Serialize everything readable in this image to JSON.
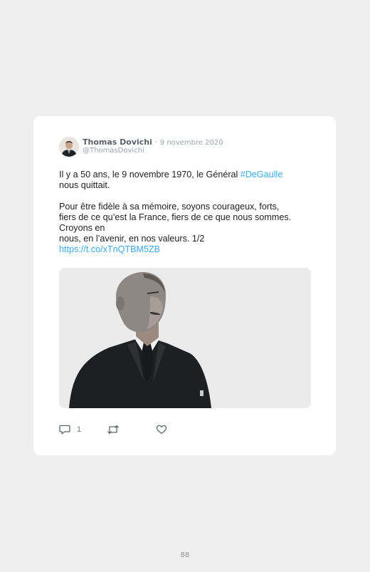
{
  "tweet": {
    "author_name": "Thomas Dovichi",
    "separator": "·",
    "date": "9 novembre 2020",
    "handle": "@ThomasDovichi",
    "line1_text": "Il y a 50 ans, le 9 novembre 1970, le Général ",
    "hashtag": "#DeGaulle",
    "line2_text": "nous quittait.",
    "para2_line1": "Pour être fidèle à sa mémoire, soyons courageux, forts,",
    "para2_line2": "fiers de ce qu’est la France, fiers de ce que nous sommes.",
    "para2_line3": "Croyons en",
    "para2_line4": "nous, en l’avenir, en nos valeurs. 1/2",
    "url": "https://t.co/xTnQTBM5ZB",
    "reply_count": "1",
    "colors": {
      "link": "#3ba9ee",
      "name": "#585f69",
      "muted": "#9aa3ad"
    },
    "icons": {
      "reply": "reply-icon",
      "retweet": "retweet-icon",
      "like": "heart-icon"
    }
  },
  "page": {
    "number": "88"
  }
}
